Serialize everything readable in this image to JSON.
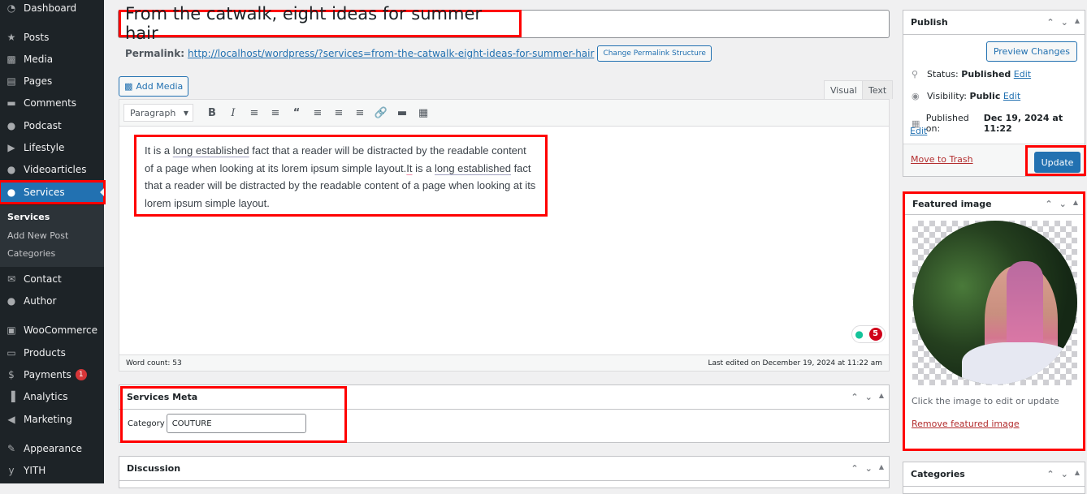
{
  "sidebar": {
    "items": [
      {
        "label": "Dashboard",
        "icon": "dashboard-icon"
      },
      {
        "label": "Posts",
        "icon": "pin-icon"
      },
      {
        "label": "Media",
        "icon": "media-icon"
      },
      {
        "label": "Pages",
        "icon": "pages-icon"
      },
      {
        "label": "Comments",
        "icon": "comment-icon"
      },
      {
        "label": "Podcast",
        "icon": "user-icon"
      },
      {
        "label": "Lifestyle",
        "icon": "video-icon"
      },
      {
        "label": "Videoarticles",
        "icon": "user-icon"
      },
      {
        "label": "Services",
        "icon": "user-icon",
        "active": true
      },
      {
        "label": "Contact",
        "icon": "envelope-icon"
      },
      {
        "label": "Author",
        "icon": "user-icon"
      },
      {
        "label": "WooCommerce",
        "icon": "woo-icon"
      },
      {
        "label": "Products",
        "icon": "archive-icon"
      },
      {
        "label": "Payments",
        "icon": "dollar-icon",
        "badge": "1"
      },
      {
        "label": "Analytics",
        "icon": "bar-chart-icon"
      },
      {
        "label": "Marketing",
        "icon": "megaphone-icon"
      },
      {
        "label": "Appearance",
        "icon": "brush-icon"
      },
      {
        "label": "YITH",
        "icon": "yith-icon"
      }
    ],
    "submenu": [
      "Services",
      "Add New Post",
      "Categories"
    ]
  },
  "post": {
    "title": "From the catwalk, eight ideas for summer hair",
    "permalink_label": "Permalink:",
    "permalink_url": "http://localhost/wordpress/?services=from-the-catwalk-eight-ideas-for-summer-hair",
    "change_permalink_label": "Change Permalink Structure"
  },
  "editor": {
    "add_media_label": "Add Media",
    "tabs": [
      "Visual",
      "Text"
    ],
    "format_select": "Paragraph",
    "content": {
      "p1": "It is a ",
      "u1": "long established",
      "p2": " fact that a reader will be distracted by the readable content of a page when looking at its lorem ipsum simple layout.",
      "u2": "It",
      "p3": " is a ",
      "u3": "long established",
      "p4": " fact that a reader will be distracted by the readable content of a page when looking at its lorem ipsum simple layout."
    },
    "grammar_count": "5",
    "word_count": "Word count: 53",
    "last_edited": "Last edited on December 19, 2024 at 11:22 am"
  },
  "services_meta": {
    "title": "Services Meta",
    "category_label": "Category",
    "category_value": "COUTURE"
  },
  "discussion": {
    "title": "Discussion"
  },
  "publish": {
    "title": "Publish",
    "preview_label": "Preview Changes",
    "status_label": "Status:",
    "status_value": "Published",
    "visibility_label": "Visibility:",
    "visibility_value": "Public",
    "published_on_label": "Published on:",
    "published_on_value": "Dec 19, 2024 at 11:22",
    "edit_label": "Edit",
    "trash_label": "Move to Trash",
    "update_label": "Update"
  },
  "featured_image": {
    "title": "Featured image",
    "hint": "Click the image to edit or update",
    "remove_label": "Remove featured image"
  },
  "categories_box": {
    "title": "Categories"
  }
}
